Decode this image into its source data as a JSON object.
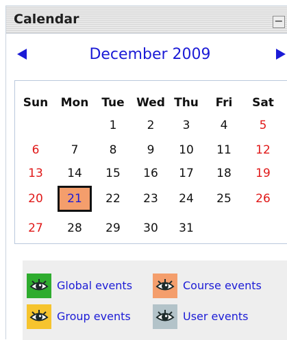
{
  "block": {
    "title": "Calendar",
    "collapse_glyph": "−"
  },
  "navigation": {
    "month_title": "December 2009",
    "prev_icon": "left-triangle",
    "next_icon": "right-triangle"
  },
  "weekdays": [
    "Sun",
    "Mon",
    "Tue",
    "Wed",
    "Thu",
    "Fri",
    "Sat"
  ],
  "weeks": [
    [
      "",
      "",
      "1",
      "2",
      "3",
      "4",
      "5"
    ],
    [
      "6",
      "7",
      "8",
      "9",
      "10",
      "11",
      "12"
    ],
    [
      "13",
      "14",
      "15",
      "16",
      "17",
      "18",
      "19"
    ],
    [
      "20",
      "21",
      "22",
      "23",
      "24",
      "25",
      "26"
    ],
    [
      "27",
      "28",
      "29",
      "30",
      "31",
      "",
      ""
    ]
  ],
  "today": "21",
  "legend": [
    {
      "label": "Global events",
      "color": "#2eac2e",
      "icon": "eye-icon"
    },
    {
      "label": "Course events",
      "color": "#f49e6c",
      "icon": "eye-icon"
    },
    {
      "label": "Group events",
      "color": "#f6c42e",
      "icon": "eye-icon"
    },
    {
      "label": "User events",
      "color": "#b3c3c9",
      "icon": "eye-icon"
    }
  ],
  "colors": {
    "link": "#1b1bd6",
    "weekend": "#e01818",
    "today_bg": "#f49e6c"
  }
}
